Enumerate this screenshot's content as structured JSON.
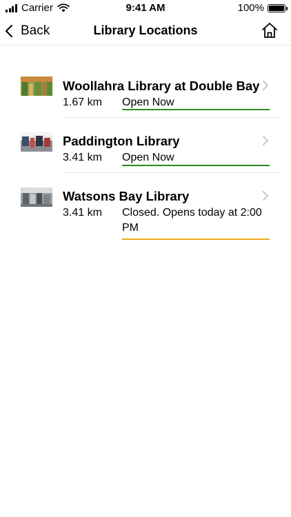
{
  "status_bar": {
    "carrier": "Carrier",
    "time": "9:41 AM",
    "battery": "100%"
  },
  "nav": {
    "back_label": "Back",
    "title": "Library Locations",
    "home_icon": "home-icon"
  },
  "libraries": [
    {
      "name": "Woollahra Library at Double Bay",
      "distance": "1.67 km",
      "status": "Open Now",
      "status_color": "#2b8a1e"
    },
    {
      "name": "Paddington Library",
      "distance": "3.41 km",
      "status": "Open Now",
      "status_color": "#2b8a1e"
    },
    {
      "name": "Watsons Bay Library",
      "distance": "3.41 km",
      "status": "Closed. Opens today at 2:00 PM",
      "status_color": "#f0a81c"
    }
  ],
  "colors": {
    "open": "#2b8a1e",
    "closed": "#f0a81c",
    "divider": "#e6e6e6",
    "chevron": "#c7c7cc"
  }
}
